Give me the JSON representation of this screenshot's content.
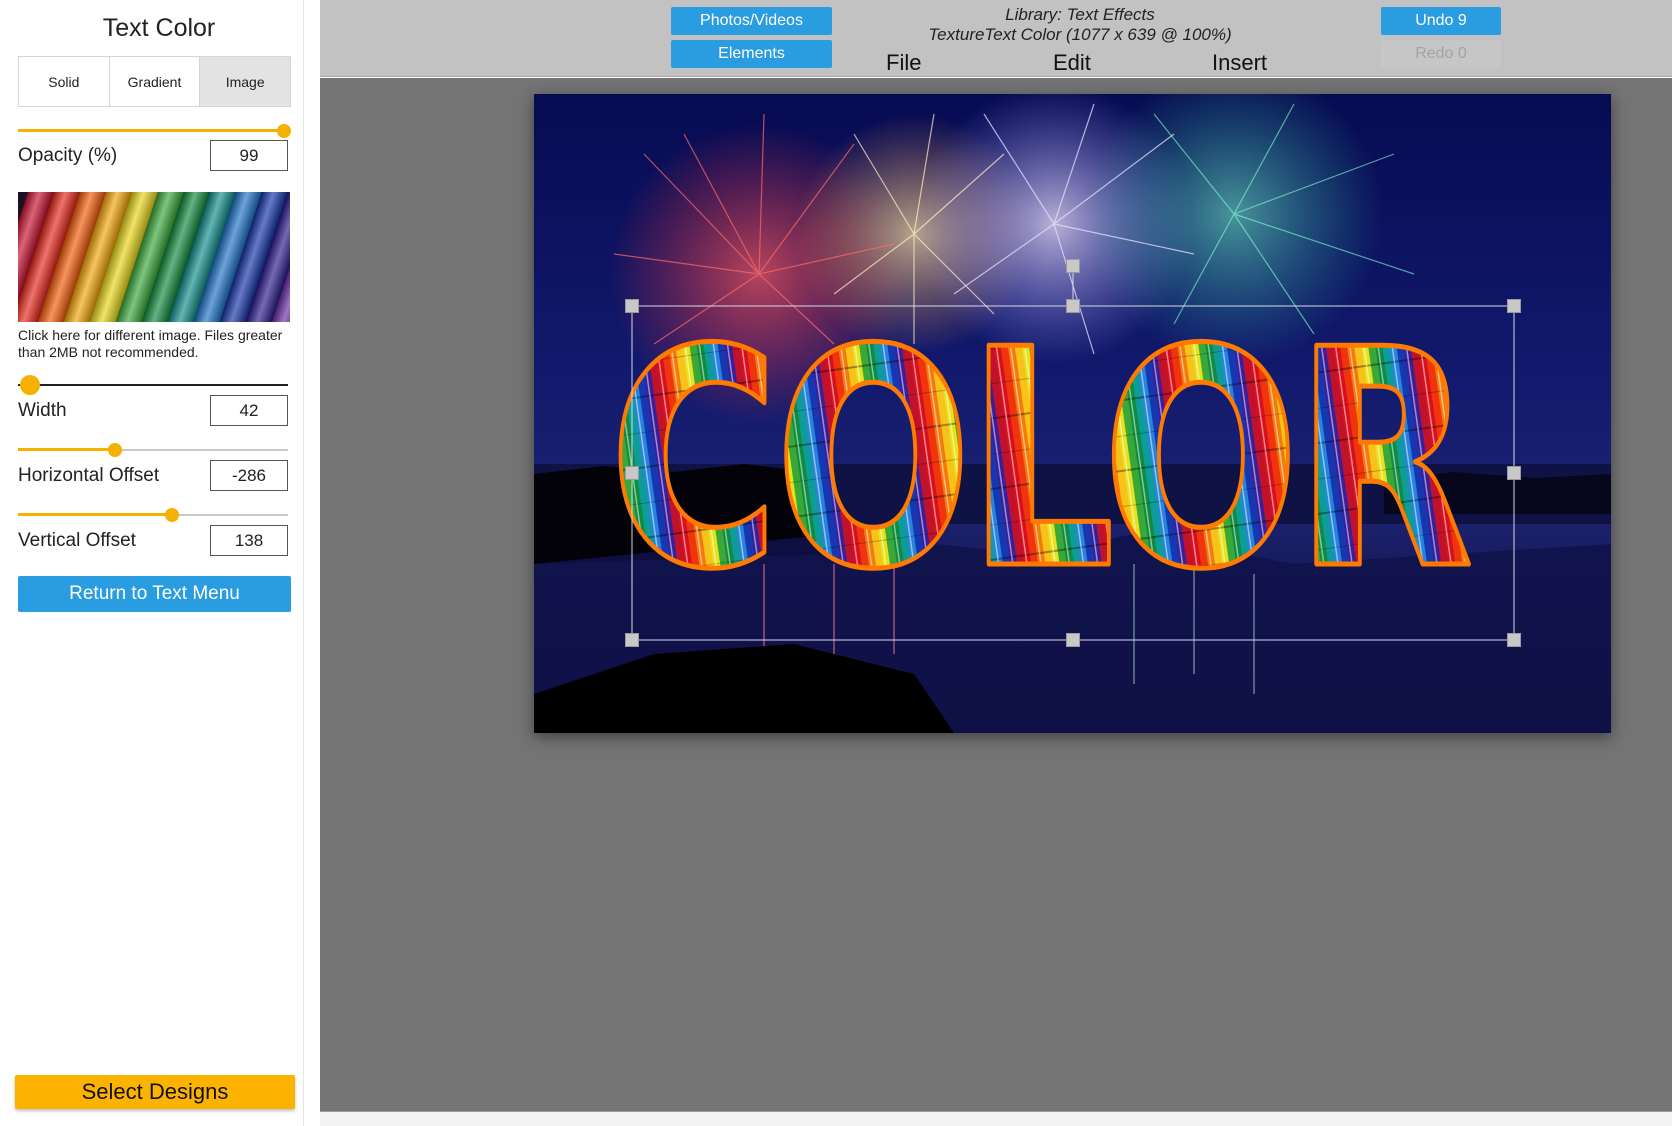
{
  "sidebar": {
    "title": "Text Color",
    "tabs": [
      {
        "label": "Solid",
        "active": false
      },
      {
        "label": "Gradient",
        "active": false
      },
      {
        "label": "Image",
        "active": true
      }
    ],
    "opacity": {
      "label": "Opacity (%)",
      "value": "99",
      "slider_fraction": 0.99
    },
    "texture": {
      "name": "rainbow-pencils-texture",
      "note": "Click here for different image. Files greater than 2MB not recommended."
    },
    "width": {
      "label": "Width",
      "value": "42"
    },
    "horizontal_offset": {
      "label": "Horizontal Offset",
      "value": "-286"
    },
    "vertical_offset": {
      "label": "Vertical Offset",
      "value": "138"
    },
    "return_button": "Return to Text Menu",
    "select_designs": "Select Designs"
  },
  "topbar": {
    "photos_videos": "Photos/Videos",
    "elements": "Elements",
    "library_line": "Library: Text Effects",
    "document_line": "TextureText Color (1077 x 639 @ 100%)",
    "menu": [
      "File",
      "Edit",
      "Insert"
    ],
    "undo": "Undo 9",
    "redo": "Redo 0"
  },
  "canvas": {
    "text": "COLOR",
    "background": "fireworks-night-sky",
    "outline_color": "#ff7a00"
  },
  "colors": {
    "accent_blue": "#2a9ce0",
    "slider_orange": "#f5b000",
    "select_yellow": "#fbb300",
    "workspace_gray": "#747474"
  }
}
